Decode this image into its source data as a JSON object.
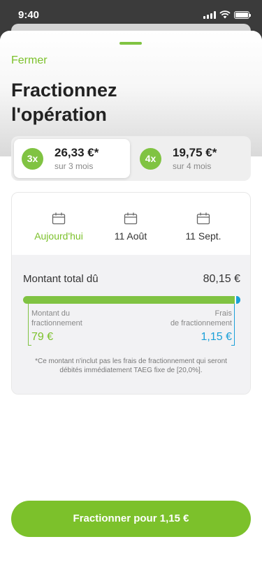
{
  "status_bar": {
    "time": "9:40"
  },
  "sheet": {
    "close_label": "Fermer",
    "title_line1": "Fractionnez",
    "title_line2": "l'opération"
  },
  "options": [
    {
      "badge": "3x",
      "amount": "26,33 €*",
      "duration": "sur 3 mois",
      "selected": true
    },
    {
      "badge": "4x",
      "amount": "19,75 €*",
      "duration": "sur 4 mois",
      "selected": false
    }
  ],
  "schedule": {
    "dates": [
      {
        "label": "Aujourd'hui",
        "active": true,
        "icon": "calendar-icon"
      },
      {
        "label": "11 Août",
        "active": false,
        "icon": "calendar-icon"
      },
      {
        "label": "11 Sept.",
        "active": false,
        "icon": "calendar-icon"
      }
    ]
  },
  "summary": {
    "total_label": "Montant total dû",
    "total_value": "80,15 €",
    "fractionnement_label_1": "Montant du",
    "fractionnement_label_2": "fractionnement",
    "fractionnement_value": "79 €",
    "fees_label_1": "Frais",
    "fees_label_2": "de fractionnement",
    "fees_value": "1,15 €",
    "fractionnement_share": 0.986,
    "fees_share": 0.014,
    "note": "*Ce montant n'inclut pas les frais de fractionnement qui seront débités immédiatement TAEG fixe de [20,0%]."
  },
  "cta": {
    "label": "Fractionner pour 1,15 €"
  },
  "colors": {
    "accent": "#7cc12b",
    "fees": "#1aa0d8",
    "text": "#222222"
  }
}
